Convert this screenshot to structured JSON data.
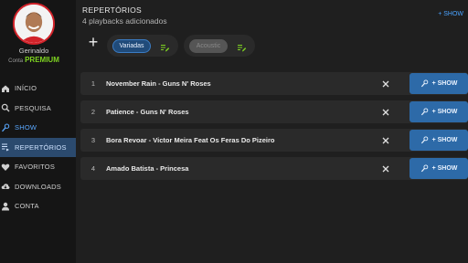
{
  "user": {
    "name": "Gerinaldo",
    "account_label": "Conta",
    "account_tier": "PREMIUM"
  },
  "nav": [
    {
      "label": "INÍCIO",
      "icon": "home-icon"
    },
    {
      "label": "PESQUISA",
      "icon": "search-icon"
    },
    {
      "label": "SHOW",
      "icon": "microphone-icon"
    },
    {
      "label": "REPERTÓRIOS",
      "icon": "playlist-icon"
    },
    {
      "label": "FAVORITOS",
      "icon": "heart-icon"
    },
    {
      "label": "DOWNLOADS",
      "icon": "cloud-download-icon"
    },
    {
      "label": "CONTA",
      "icon": "person-icon"
    }
  ],
  "header": {
    "title": "REPERTÓRIOS",
    "subtitle": "4 playbacks adicionados",
    "show_label": "+ SHOW"
  },
  "chips": [
    {
      "label": "Variadas",
      "selected": true
    },
    {
      "label": "Acoustic",
      "selected": false
    }
  ],
  "songs": [
    {
      "num": "1",
      "title": "November Rain - Guns N' Roses",
      "action": "+ SHOW"
    },
    {
      "num": "2",
      "title": "Patience - Guns N' Roses",
      "action": "+ SHOW"
    },
    {
      "num": "3",
      "title": "Bora Revoar - Victor Meira Feat Os Feras Do Pizeiro",
      "action": "+ SHOW"
    },
    {
      "num": "4",
      "title": "Amado Batista - Princesa",
      "action": "+ SHOW"
    }
  ],
  "colors": {
    "accent": "#2d6aa8",
    "premium": "#7ed321",
    "active_nav": "#2b4a6e",
    "link": "#4aa3ff"
  }
}
